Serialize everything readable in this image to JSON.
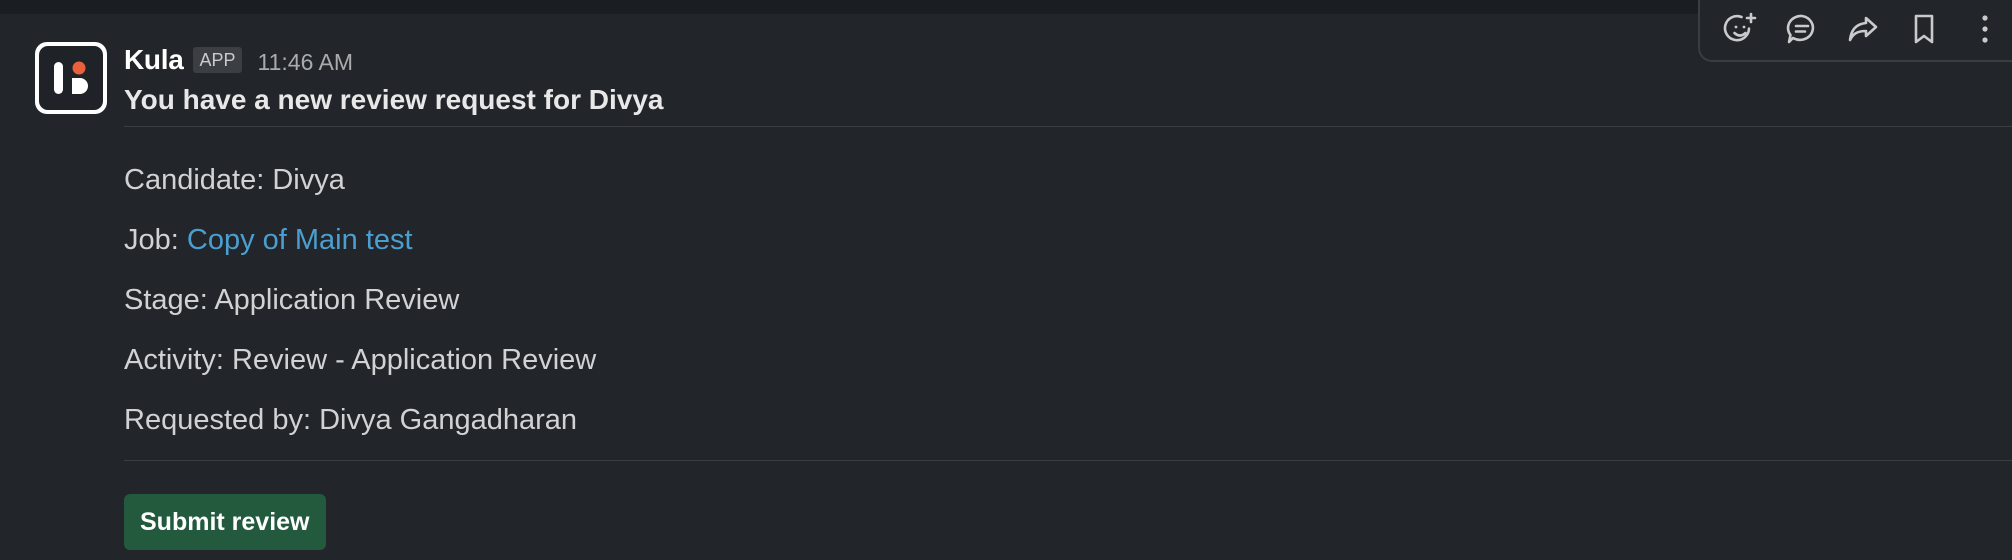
{
  "message": {
    "sender": "Kula",
    "badge": "APP",
    "time": "11:46 AM",
    "title": "You have a new review request for Divya",
    "fields": {
      "candidate": {
        "label": "Candidate:",
        "value": "Divya"
      },
      "job": {
        "label": "Job:",
        "value": "Copy of Main test"
      },
      "stage": {
        "label": "Stage:",
        "value": "Application Review"
      },
      "activity": {
        "label": "Activity:",
        "value": "Review - Application Review"
      },
      "requested_by": {
        "label": "Requested by:",
        "value": "Divya Gangadharan"
      }
    },
    "action_label": "Submit review"
  },
  "toolbar": {
    "icons": [
      "add-reaction-icon",
      "reply-in-thread-icon",
      "share-message-icon",
      "save-bookmark-icon",
      "more-actions-icon"
    ]
  },
  "colors": {
    "background": "#222529",
    "link": "#4a9fd0",
    "button": "#235a3e",
    "logo_accent": "#e8603c"
  }
}
